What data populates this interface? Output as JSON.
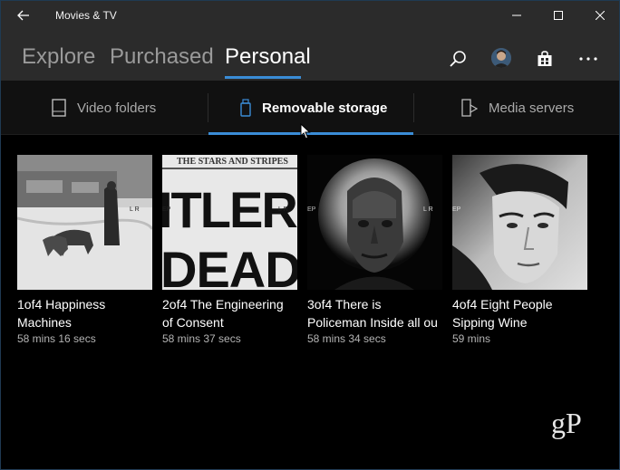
{
  "window": {
    "title": "Movies & TV",
    "controls": {
      "minimize_icon": "minimize-icon",
      "maximize_icon": "maximize-icon",
      "close_icon": "close-icon"
    }
  },
  "pivot": {
    "tabs": [
      {
        "label": "Explore",
        "active": false
      },
      {
        "label": "Purchased",
        "active": false
      },
      {
        "label": "Personal",
        "active": true
      }
    ],
    "accent": "#3a8cd6"
  },
  "header_actions": {
    "search_icon": "search-icon",
    "store_icon": "store-bag-icon",
    "more_icon": "more-ellipsis-icon"
  },
  "subnav": {
    "items": [
      {
        "label": "Video folders",
        "icon": "folder-icon",
        "active": false
      },
      {
        "label": "Removable storage",
        "icon": "usb-drive-icon",
        "active": true
      },
      {
        "label": "Media servers",
        "icon": "media-server-icon",
        "active": false
      }
    ]
  },
  "videos": [
    {
      "title_line1": "1of4 Happiness",
      "title_line2": "Machines",
      "duration": "58 mins 16 secs"
    },
    {
      "title_line1": "2of4 The Engineering",
      "title_line2": "of Consent",
      "duration": "58 mins 37 secs"
    },
    {
      "title_line1": "3of4 There is",
      "title_line2": "Policeman Inside all ou",
      "duration": "58 mins 34 secs"
    },
    {
      "title_line1": "4of4 Eight People",
      "title_line2": "Sipping Wine",
      "duration": "59 mins"
    }
  ],
  "thumb_text": {
    "newspaper_masthead": "THE STARS AND STRIPES",
    "headline_top": "ITLER",
    "headline_bottom": "DEAD",
    "overlay_marks": [
      "L R",
      "EP"
    ]
  },
  "watermark": "gP"
}
